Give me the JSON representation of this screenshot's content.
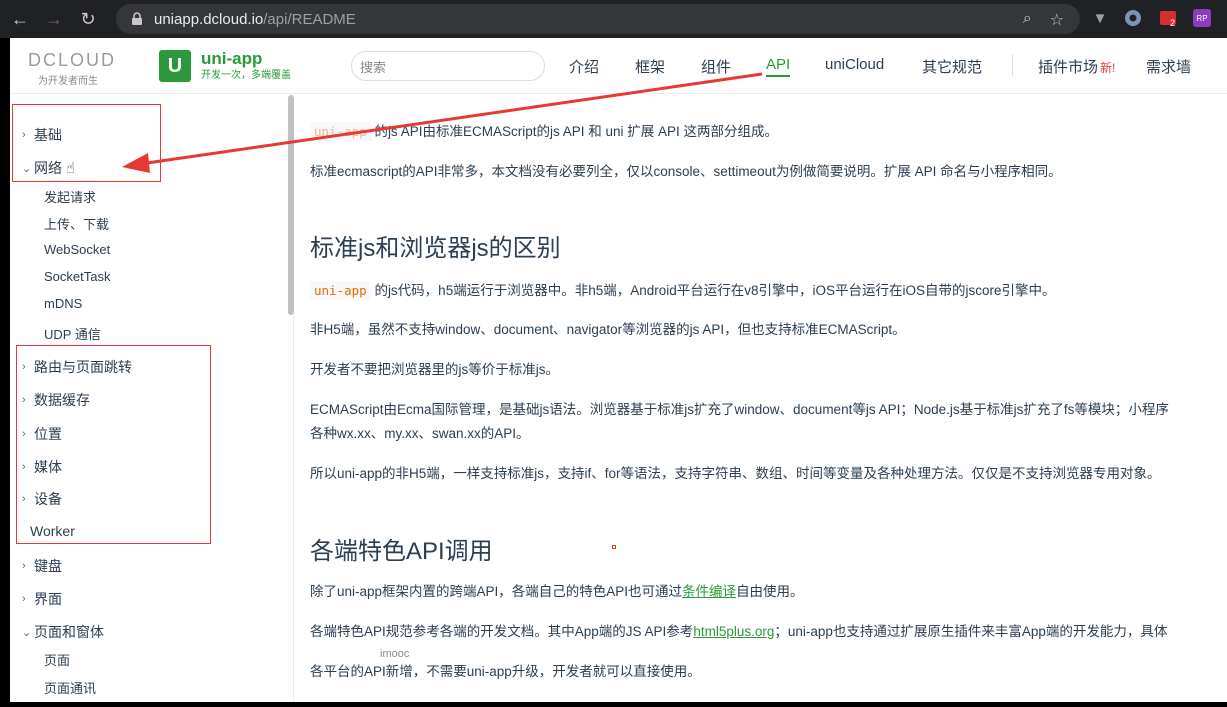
{
  "browser": {
    "url_host": "uniapp.dcloud.io",
    "url_path": "/api/README",
    "ext_badge": "2",
    "ext_rp": "RP"
  },
  "header": {
    "dcloud_logo": "DCLOUD",
    "dcloud_slogan": "为开发者而生",
    "uni_icon": "U",
    "uni_name": "uni-app",
    "uni_slogan": "开发一次，多端覆盖",
    "search_placeholder": "搜索",
    "menu": [
      "介绍",
      "框架",
      "组件",
      "API",
      "uniCloud",
      "其它规范",
      "插件市场",
      "需求墙"
    ],
    "menu_new": "新!",
    "active_menu": "API"
  },
  "sidebar": {
    "items": [
      "基础",
      "网络",
      "路由与页面跳转",
      "数据缓存",
      "位置",
      "媒体",
      "设备",
      "Worker",
      "键盘",
      "界面",
      "页面和窗体"
    ],
    "network_children": [
      "发起请求",
      "上传、下载",
      "WebSocket",
      "SocketTask",
      "mDNS",
      "UDP 通信"
    ],
    "window_children": [
      "页面",
      "页面通讯"
    ]
  },
  "content": {
    "intro_code": "uni-app",
    "intro_text": " 的js API由标准ECMAScript的js API 和 uni 扩展 API 这两部分组成。",
    "para2": "标准ecmascript的API非常多，本文档没有必要列全，仅以console、settimeout为例做简要说明。扩展 API 命名与小程序相同。",
    "h2_1": "标准js和浏览器js的区别",
    "p3_code": "uni-app",
    "p3_text": " 的js代码，h5端运行于浏览器中。非h5端，Android平台运行在v8引擎中，iOS平台运行在iOS自带的jscore引擎中。",
    "p4": "非H5端，虽然不支持window、document、navigator等浏览器的js API，但也支持标准ECMAScript。",
    "p5": "开发者不要把浏览器里的js等价于标准js。",
    "p6_line1": "ECMAScript由Ecma国际管理，是基础js语法。浏览器基于标准js扩充了window、document等js API；Node.js基于标准js扩充了fs等模块；小程序",
    "p6_line2": "各种wx.xx、my.xx、swan.xx的API。",
    "p7": "所以uni-app的非H5端，一样支持标准js，支持if、for等语法，支持字符串、数组、时间等变量及各种处理方法。仅仅是不支持浏览器专用对象。",
    "h2_2": "各端特色API调用",
    "p8_pre": "除了uni-app框架内置的跨端API，各端自己的特色API也可通过",
    "p8_link": "条件编译",
    "p8_post": "自由使用。",
    "p9_pre": "各端特色API规范参考各端的开发文档。其中App端的JS API参考",
    "p9_link": "html5plus.org",
    "p9_post": "；uni-app也支持通过扩展原生插件来丰富App端的开发能力，具体",
    "p10": "各平台的API新增，不需要uni-app升级，开发者就可以直接使用。",
    "watermark": "imooc"
  },
  "colors": {
    "brand_green": "#2b9939",
    "annotation_red": "#e53935",
    "code_orange": "#e96900"
  }
}
